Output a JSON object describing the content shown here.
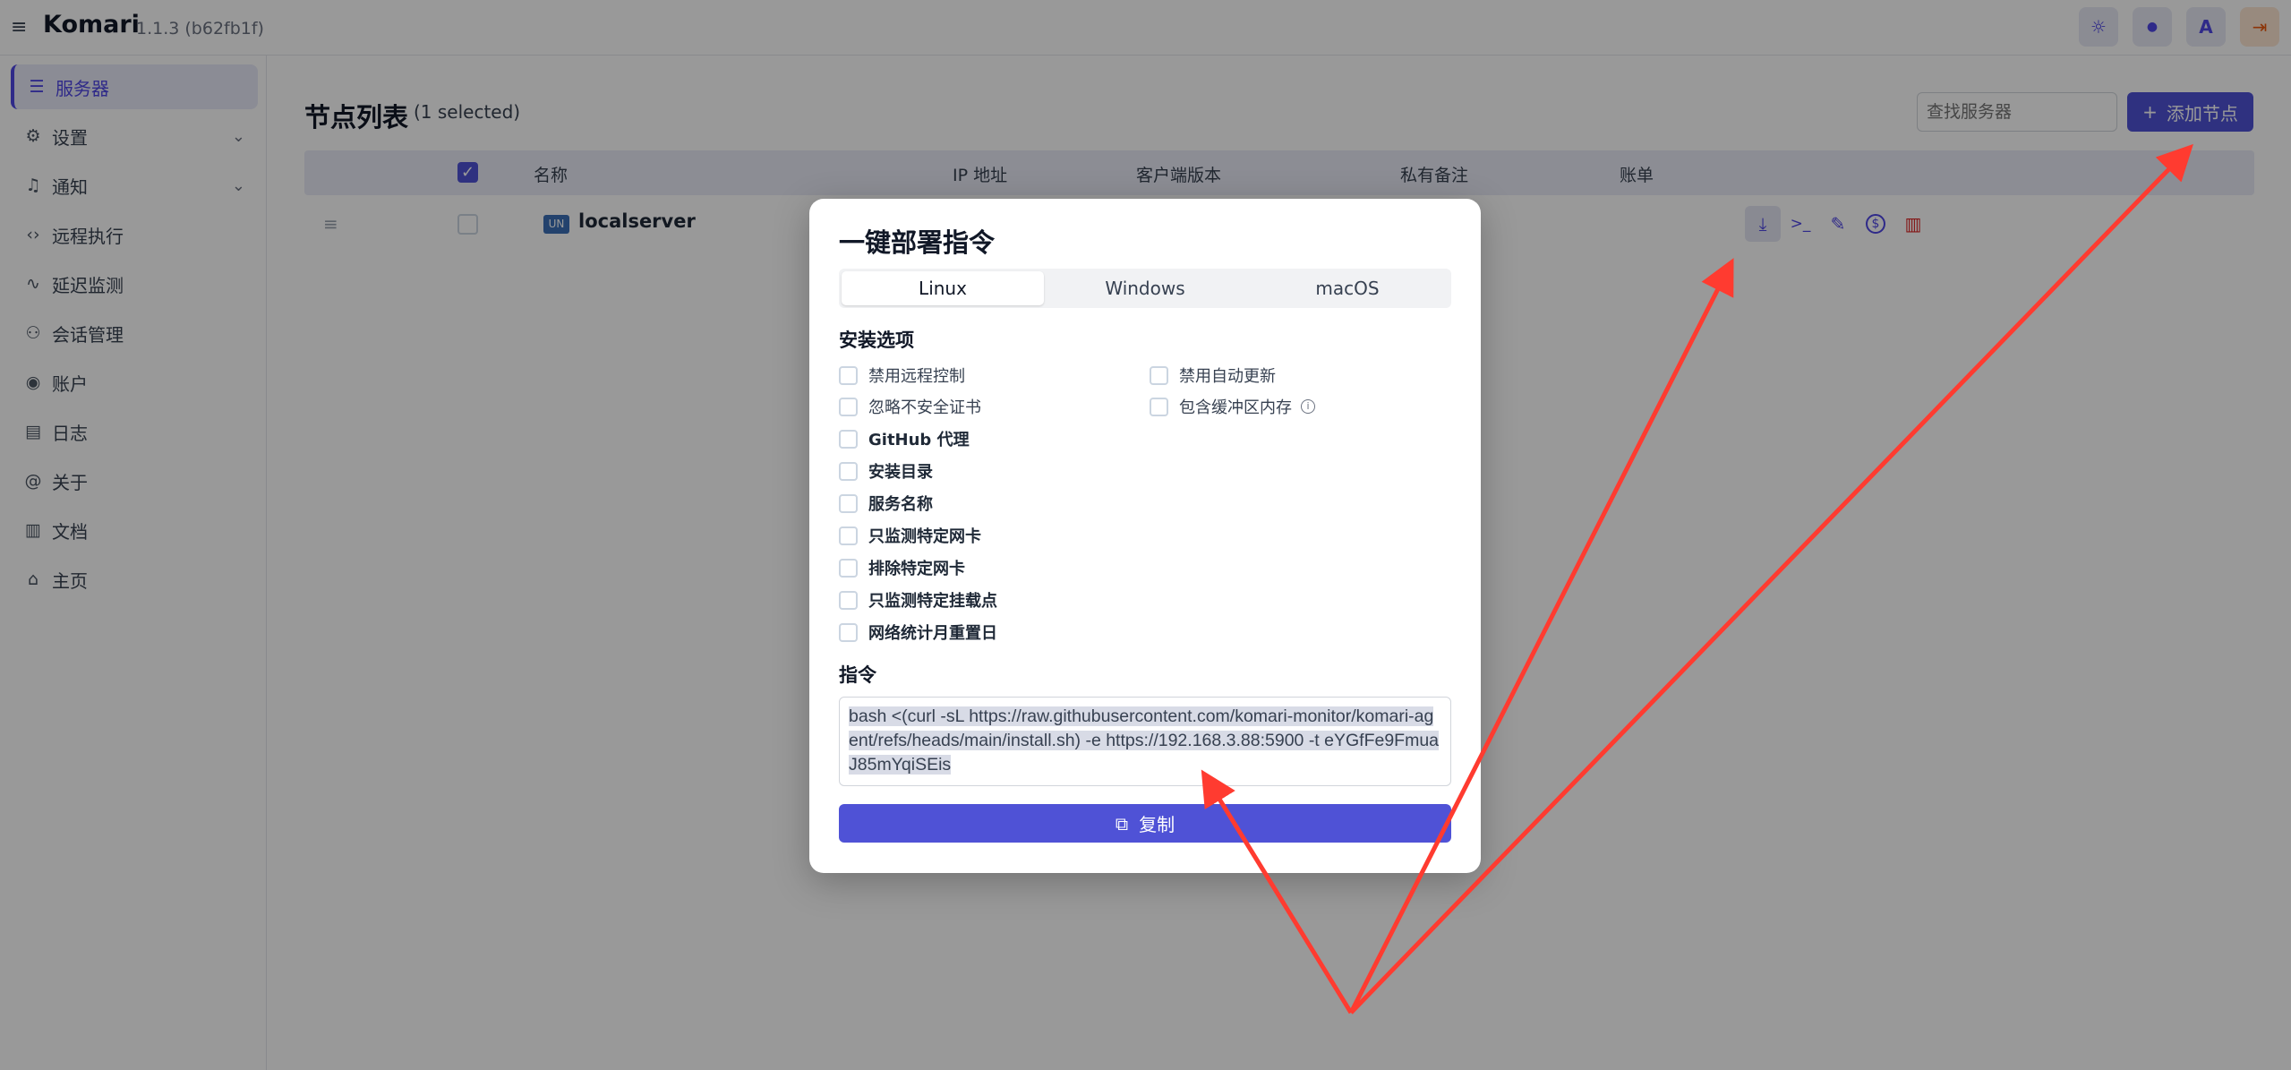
{
  "header": {
    "menu_icon": "hamburger-icon",
    "app_name": "Komari",
    "version": "1.1.3 (b62fb1f)",
    "buttons": [
      {
        "icon": "sun-icon",
        "glyph": "☼"
      },
      {
        "icon": "drop-icon",
        "glyph": "💧"
      },
      {
        "icon": "translate-icon",
        "glyph": "A"
      },
      {
        "icon": "logout-icon",
        "glyph": "⇥"
      }
    ]
  },
  "sidebar": {
    "items": [
      {
        "label": "服务器",
        "icon": "server-icon",
        "glyph": "☰",
        "active": true
      },
      {
        "label": "设置",
        "icon": "settings-icon",
        "glyph": "⚙",
        "expandable": true
      },
      {
        "label": "通知",
        "icon": "bell-icon",
        "glyph": "🔔",
        "expandable": true
      },
      {
        "label": "远程执行",
        "icon": "code-icon",
        "glyph": "‹›"
      },
      {
        "label": "延迟监测",
        "icon": "activity-icon",
        "glyph": "∿"
      },
      {
        "label": "会话管理",
        "icon": "users-icon",
        "glyph": "👥"
      },
      {
        "label": "账户",
        "icon": "user-circle-icon",
        "glyph": "◉"
      },
      {
        "label": "日志",
        "icon": "file-icon",
        "glyph": "▤"
      },
      {
        "label": "关于",
        "icon": "at-icon",
        "glyph": "@"
      },
      {
        "label": "文档",
        "icon": "book-icon",
        "glyph": "▥"
      },
      {
        "label": "主页",
        "icon": "home-icon",
        "glyph": "⌂"
      }
    ]
  },
  "main": {
    "title": "节点列表",
    "selected": "(1 selected)",
    "search_placeholder": "查找服务器",
    "add_button": "添加节点",
    "columns": [
      "名称",
      "IP 地址",
      "客户端版本",
      "私有备注",
      "账单"
    ],
    "rows": [
      {
        "name": "localserver",
        "flag": "UN"
      }
    ],
    "row_actions": [
      {
        "icon": "download-icon",
        "glyph": "⤓"
      },
      {
        "icon": "terminal-icon",
        "glyph": ">_"
      },
      {
        "icon": "edit-icon",
        "glyph": "✎"
      },
      {
        "icon": "dollar-icon",
        "glyph": "$"
      },
      {
        "icon": "trash-icon",
        "glyph": "🗑"
      }
    ]
  },
  "modal": {
    "title": "一键部署指令",
    "tabs": [
      "Linux",
      "Windows",
      "macOS"
    ],
    "install_options_label": "安装选项",
    "options_grid": [
      [
        "禁用远程控制",
        "禁用自动更新"
      ],
      [
        "忽略不安全证书",
        "包含缓冲区内存"
      ]
    ],
    "options_bold": [
      "GitHub 代理",
      "安装目录",
      "服务名称",
      "只监测特定网卡",
      "排除特定网卡",
      "只监测特定挂载点",
      "网络统计月重置日"
    ],
    "command_label": "指令",
    "command": "bash <(curl -sL https://raw.githubusercontent.com/komari-monitor/komari-agent/refs/heads/main/install.sh) -e https://192.168.3.88:5900 -t eYGfFe9FmuaJ85mYqiSEis",
    "copy_button": "复制"
  },
  "colors": {
    "accent": "#4f52d6",
    "annotation": "#ff3b30"
  }
}
